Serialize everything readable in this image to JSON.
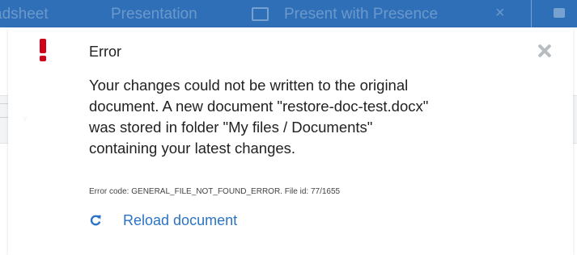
{
  "background": {
    "topbar": {
      "tab_sheet": "adsheet",
      "tab_presentation": "Presentation",
      "tab_present": "Present with Presence",
      "close_glyph": "×"
    },
    "toolbar": {
      "dropdown_caret": "▾"
    }
  },
  "error": {
    "icon": "exclamation-icon",
    "title": "Error",
    "message_lines": [
      "Your changes could not be written to the original",
      "document. A new document \"restore-doc-test.docx\"",
      "was stored in folder \"My files / Documents\"",
      "containing your latest changes."
    ],
    "error_code_text": "Error code: GENERAL_FILE_NOT_FOUND_ERROR. File id: 77/1655",
    "reload_label": "Reload document"
  },
  "colors": {
    "alert_red": "#d0021b",
    "link_blue": "#2b73c4",
    "topbar_blue": "#2f6fb7",
    "close_gray": "#b9bcbf"
  }
}
